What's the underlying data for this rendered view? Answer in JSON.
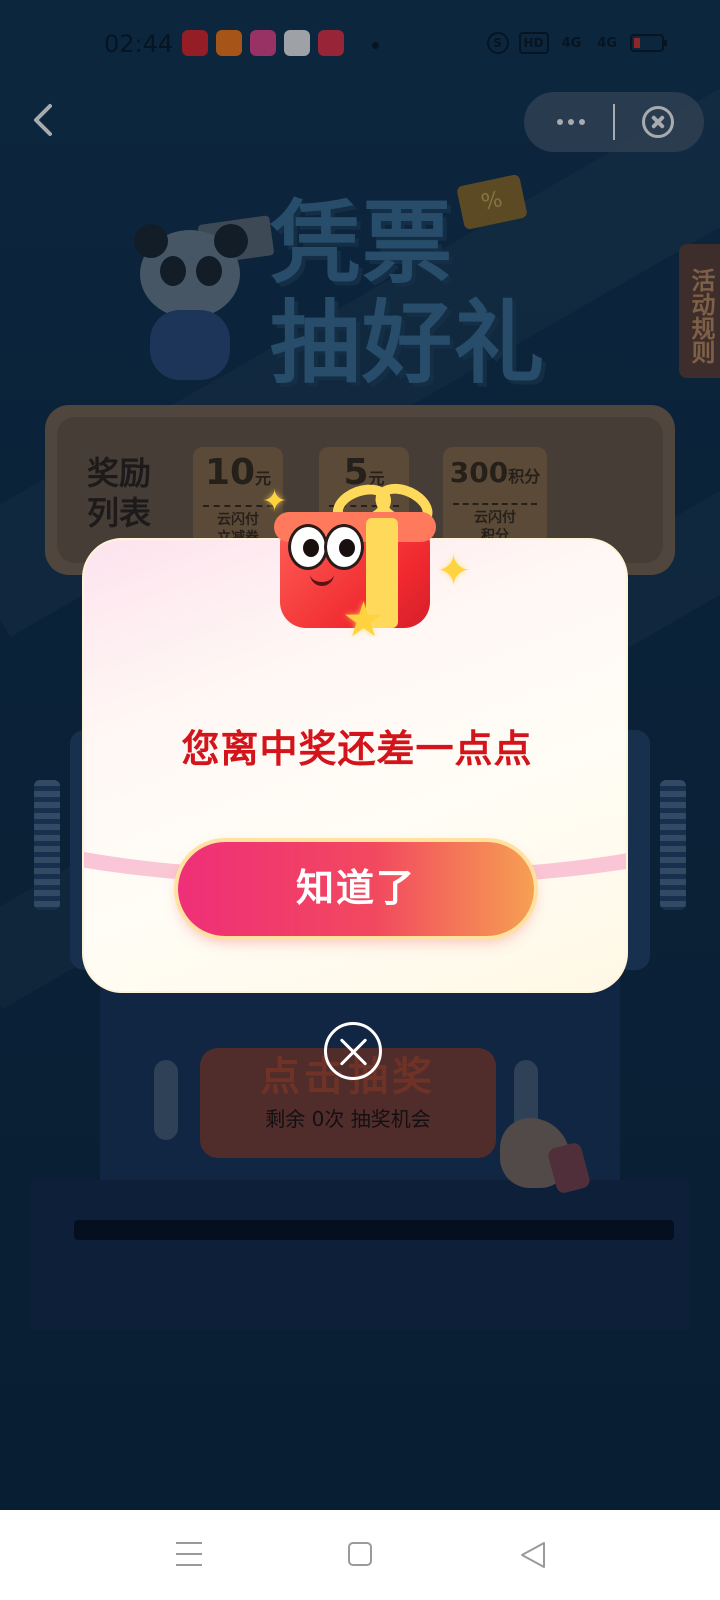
{
  "status_bar": {
    "time": "02:44",
    "apps": [
      {
        "icon": "red-shopping-app-icon",
        "color": "#e3262c"
      },
      {
        "icon": "orange-game-app-icon",
        "color": "#ff7a1a"
      },
      {
        "icon": "618-promo-app-icon",
        "color": "#e8458c"
      },
      {
        "icon": "delivery-app-icon",
        "color": "#f2f2f2"
      },
      {
        "icon": "red-book-app-icon",
        "color": "#e83247"
      }
    ],
    "hd_label": "HD",
    "signal_label": "4G"
  },
  "nav": {
    "back_icon": "chevron-left-icon",
    "more_icon": "more-dots-icon",
    "close_icon": "close-circle-icon"
  },
  "header": {
    "title_line1": "凭票",
    "title_line2": "抽好礼"
  },
  "rules_tab": "活动规则",
  "rewards": {
    "title": "奖励列表",
    "items": [
      {
        "amount": "10",
        "unit": "元",
        "desc_line1": "云闪付",
        "desc_line2": "立减券"
      },
      {
        "amount": "5",
        "unit": "元",
        "desc_line1": "",
        "desc_line2": ""
      },
      {
        "amount": "300",
        "unit": "积分",
        "desc_line1": "云闪付",
        "desc_line2": "积分"
      }
    ]
  },
  "draw_button": {
    "label": "点击抽奖",
    "sub_label": "剩余 0次 抽奖机会"
  },
  "dialog": {
    "message": "您离中奖还差一点点",
    "confirm_label": "知道了"
  },
  "colors": {
    "accent_red": "#d4141b",
    "button_pink": "#ef2f78",
    "button_orange": "#f6a052",
    "background_navy": "#0f2b44"
  }
}
